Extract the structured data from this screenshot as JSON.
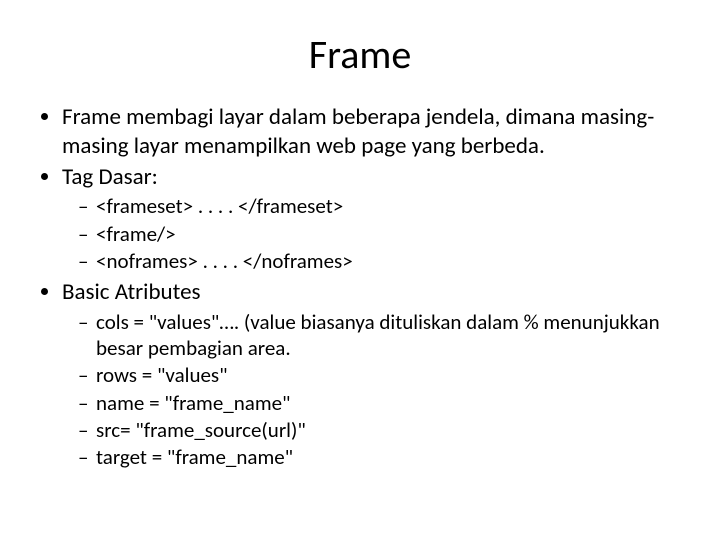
{
  "title": "Frame",
  "bullets": {
    "b1": "Frame membagi layar dalam beberapa jendela, dimana masing-masing layar menampilkan web page yang berbeda.",
    "b2": "Tag Dasar:",
    "b2_items": {
      "i1": "<frameset> . . . . </frameset>",
      "i2": "<frame/>",
      "i3": "<noframes> . . . . </noframes>"
    },
    "b3": "Basic Atributes",
    "b3_items": {
      "i1": "cols = \"values\"…. (value biasanya dituliskan dalam % menunjukkan besar pembagian area.",
      "i2": "rows = \"values\"",
      "i3": "name = \"frame_name\"",
      "i4": "src= \"frame_source(url)\"",
      "i5": "target = \"frame_name\""
    }
  }
}
